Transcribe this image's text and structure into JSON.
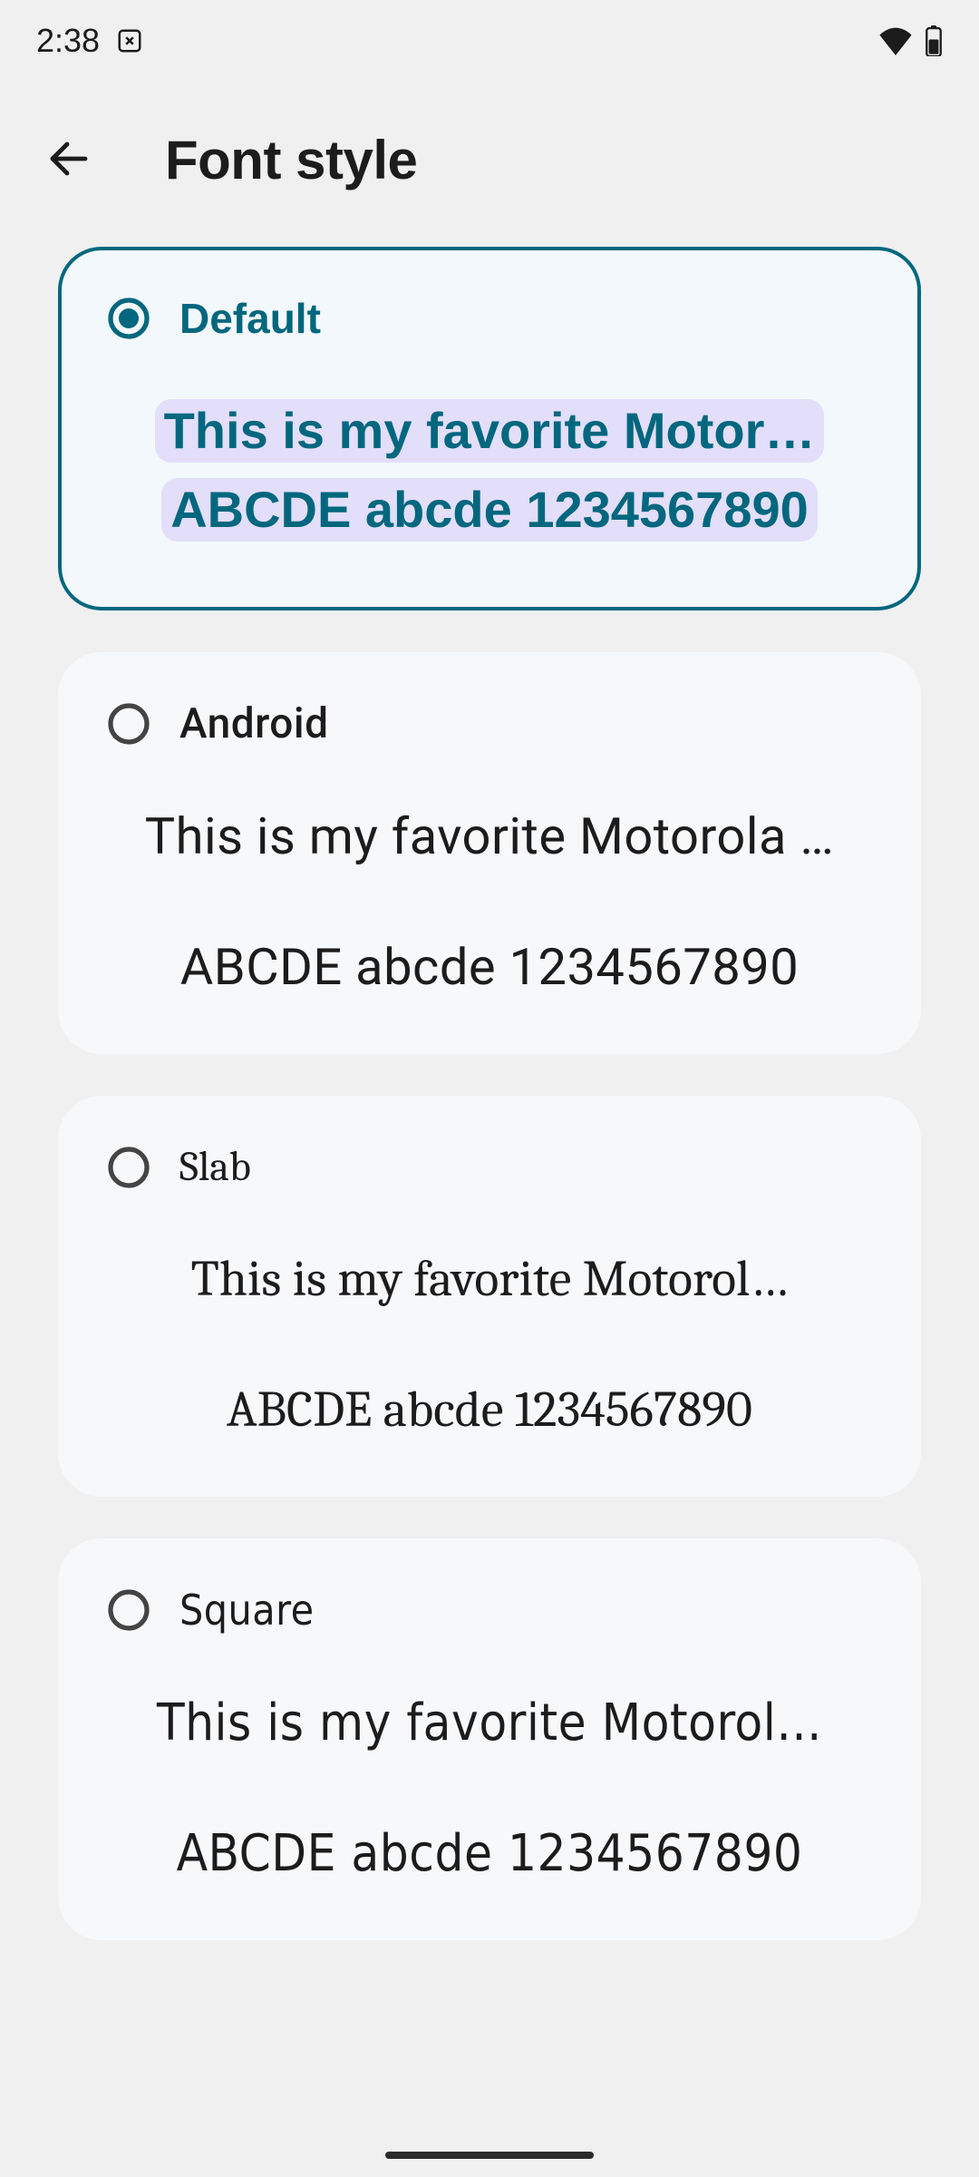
{
  "statusbar": {
    "time": "2:38"
  },
  "header": {
    "title": "Font style"
  },
  "options": [
    {
      "id": "default",
      "label": "Default",
      "sample_line1": "This is my favorite Motor…",
      "sample_line2": "ABCDE abcde 1234567890",
      "selected": true,
      "font_class": "font-default"
    },
    {
      "id": "android",
      "label": "Android",
      "sample_line1": "This is my favorite Motorola …",
      "sample_line2": "ABCDE abcde 1234567890",
      "selected": false,
      "font_class": "font-android"
    },
    {
      "id": "slab",
      "label": "Slab",
      "sample_line1": "This is my favorite Motorol…",
      "sample_line2": "ABCDE abcde 1234567890",
      "selected": false,
      "font_class": "font-slab"
    },
    {
      "id": "square",
      "label": "Square",
      "sample_line1": "This is my favorite Motorol…",
      "sample_line2": "ABCDE abcde 1234567890",
      "selected": false,
      "font_class": "font-square"
    }
  ],
  "colors": {
    "accent": "#00677e",
    "highlight": "#e3defa",
    "card_bg": "#f7f8fa",
    "card_selected_bg": "#f3f8fc",
    "page_bg": "#f0f0f1"
  }
}
